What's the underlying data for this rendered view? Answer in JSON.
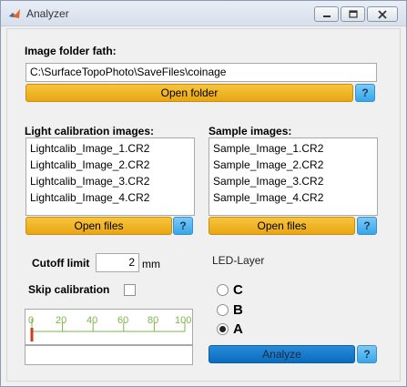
{
  "window": {
    "title": "Analyzer"
  },
  "folder": {
    "label": "Image folder fath:",
    "path": "C:\\SurfaceTopoPhoto\\SaveFiles\\coinage",
    "open_button": "Open folder",
    "help": "?"
  },
  "light_calibration": {
    "label": "Light calibration images:",
    "items": [
      "Lightcalib_Image_1.CR2",
      "Lightcalib_Image_2.CR2",
      "Lightcalib_Image_3.CR2",
      "Lightcalib_Image_4.CR2"
    ],
    "open_button": "Open files",
    "help": "?"
  },
  "sample": {
    "label": "Sample images:",
    "items": [
      "Sample_Image_1.CR2",
      "Sample_Image_2.CR2",
      "Sample_Image_3.CR2",
      "Sample_Image_4.CR2"
    ],
    "open_button": "Open files",
    "help": "?"
  },
  "cutoff": {
    "label": "Cutoff limit",
    "value": "2",
    "unit": "mm"
  },
  "skip_calibration": {
    "label": "Skip calibration",
    "checked": false
  },
  "led_layer": {
    "label": "LED-Layer",
    "options": [
      {
        "label": "C",
        "selected": false
      },
      {
        "label": "B",
        "selected": false
      },
      {
        "label": "A",
        "selected": true
      }
    ]
  },
  "gauge": {
    "ticks": [
      "0",
      "20",
      "40",
      "60",
      "80",
      "100"
    ],
    "value": 0,
    "color": "#7ab648"
  },
  "analyze": {
    "button": "Analyze",
    "help": "?"
  },
  "colors": {
    "orange_button": "#f0b429",
    "blue_button": "#1a7ccc",
    "help_button": "#55b8ee"
  }
}
